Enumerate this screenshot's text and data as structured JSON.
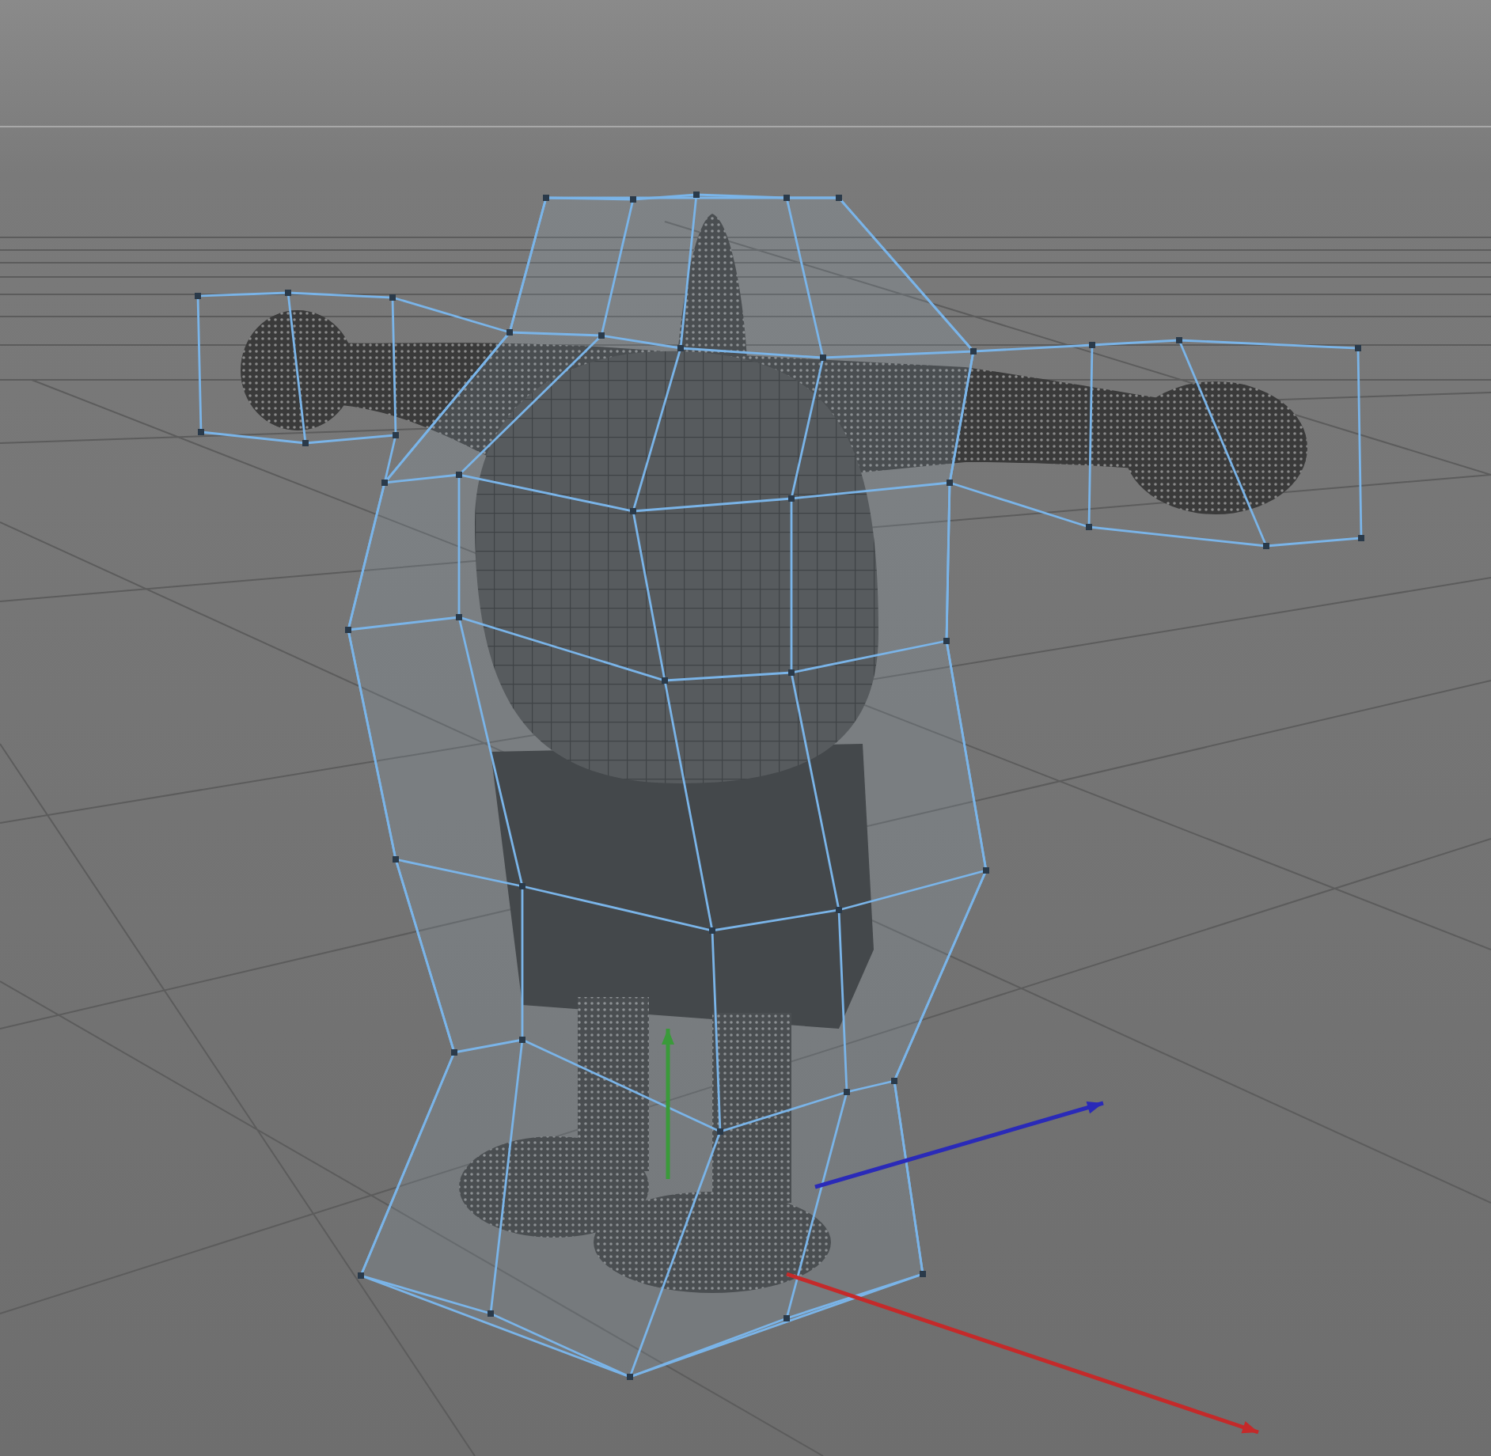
{
  "viewport": {
    "axes": [
      {
        "color": "#c42a2a"
      },
      {
        "color": "#3a9a3a"
      },
      {
        "color": "#2a2ab8"
      }
    ]
  }
}
